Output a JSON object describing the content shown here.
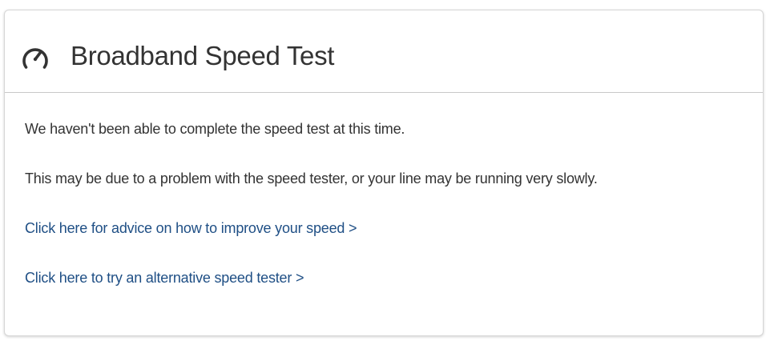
{
  "header": {
    "title": "Broadband Speed Test",
    "icon": "speedometer-icon"
  },
  "body": {
    "message_1": "We haven't been able to complete the speed test at this time.",
    "message_2": "This may be due to a problem with the speed tester, or your line may be running very slowly.",
    "link_advice": "Click here for advice on how to improve your speed >",
    "link_alternative": "Click here to try an alternative speed tester >"
  },
  "colors": {
    "text": "#333333",
    "link": "#1f4f85",
    "border": "#c8c8c8"
  }
}
